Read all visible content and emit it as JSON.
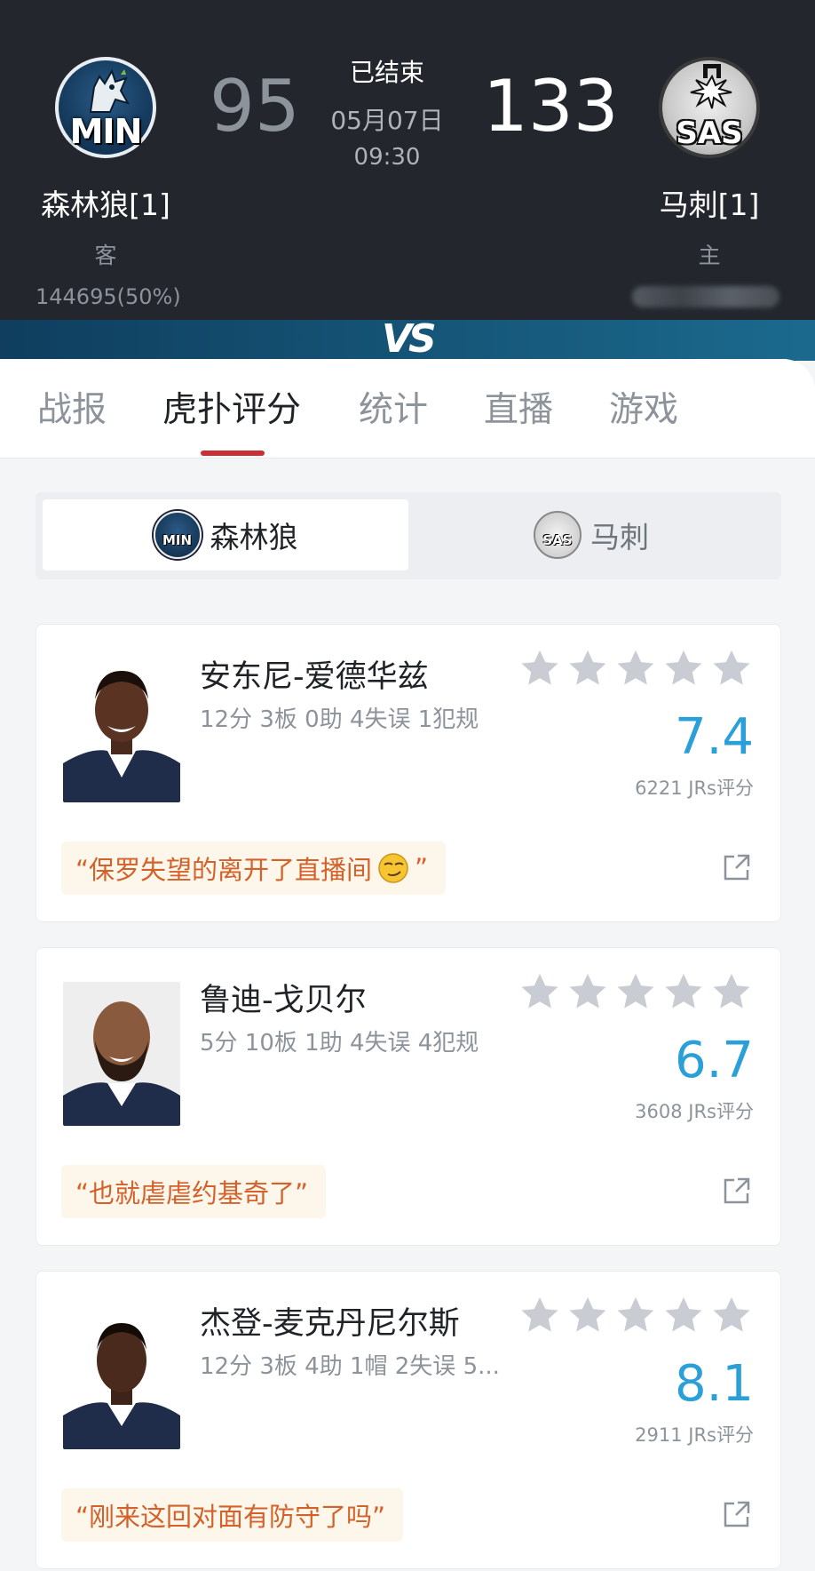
{
  "header": {
    "away": {
      "abbr": "MIN",
      "name": "森林狼[1]",
      "side": "客",
      "score": "95",
      "votes": "144695(50%)"
    },
    "home": {
      "abbr": "SAS",
      "name": "马刺[1]",
      "side": "主",
      "score": "133"
    },
    "status": "已结束",
    "date": "05月07日",
    "time": "09:30",
    "vs_label": "VS"
  },
  "tabs": [
    "战报",
    "虎扑评分",
    "统计",
    "直播",
    "游戏"
  ],
  "active_tab": "虎扑评分",
  "team_toggle": {
    "active": {
      "label": "森林狼",
      "abbr": "MIN"
    },
    "inactive": {
      "label": "马刺",
      "abbr": "SAS"
    }
  },
  "players": [
    {
      "name": "安东尼-爱德华兹",
      "stats": "12分 3板 0助 4失误 1犯规",
      "rating": "7.4",
      "rating_count": "6221 JRs评分",
      "quote": "“保罗失望的离开了直播间",
      "quote_end": "”",
      "stars": 5,
      "icon": "smirk-emoji"
    },
    {
      "name": "鲁迪-戈贝尔",
      "stats": "5分 10板 1助 4失误 4犯规",
      "rating": "6.7",
      "rating_count": "3608 JRs评分",
      "quote": "“也就虐虐约基奇了”",
      "stars": 5
    },
    {
      "name": "杰登-麦克丹尼尔斯",
      "stats": "12分 3板 4助 1帽 2失误 5...",
      "rating": "8.1",
      "rating_count": "2911 JRs评分",
      "quote": "“刚来这回对面有防守了吗”",
      "stars": 5
    }
  ],
  "colors": {
    "header_bg": "#23272d",
    "accent_red": "#c92f34",
    "rating_blue": "#2a9fd8",
    "quote_text": "#d4612a",
    "quote_bg": "#fdf6ea",
    "star_gray": "#c9ccd3"
  }
}
